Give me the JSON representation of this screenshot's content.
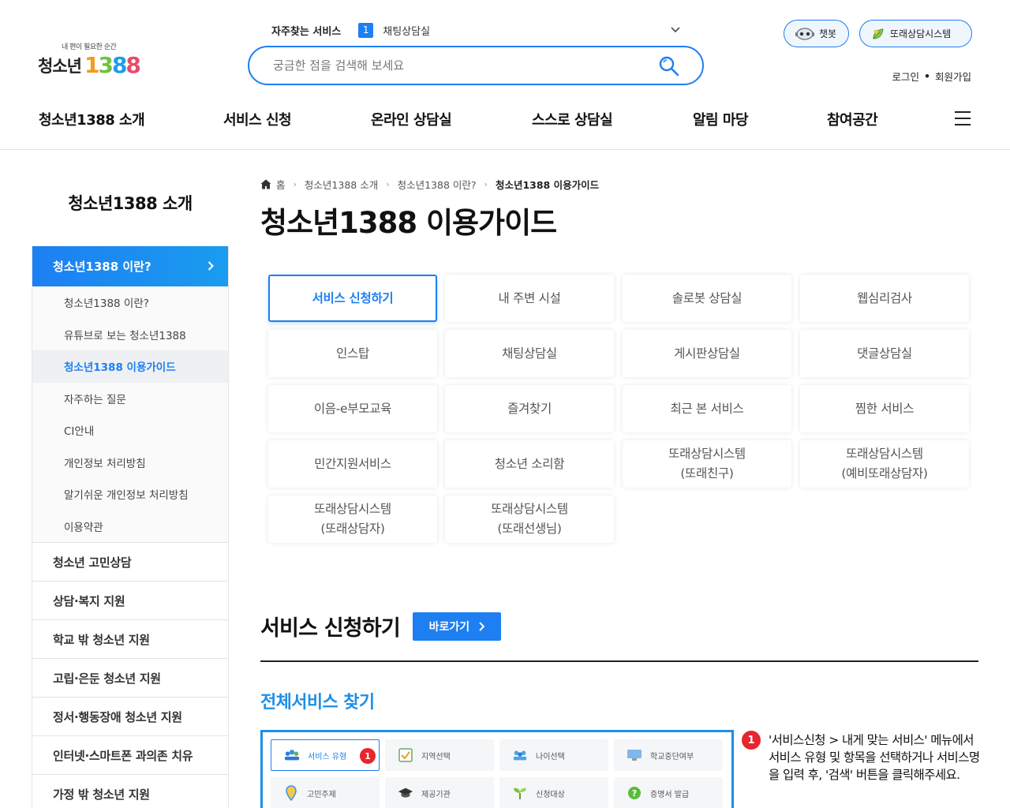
{
  "header": {
    "logo_tagline": "내 편이 필요한 순간",
    "logo_text": "청소년",
    "logo_digits": [
      "1",
      "3",
      "8",
      "8"
    ],
    "faq_label": "자주찾는 서비스",
    "faq_rank": "1",
    "faq_item": "채팅상담실",
    "search_placeholder": "궁금한 점을 검색해 보세요",
    "chatbot_label": "챗봇",
    "ttorae_label": "또래상담시스템",
    "login_label": "로그인",
    "signup_label": "회원가입",
    "separator": "•"
  },
  "gnb": [
    "청소년1388 소개",
    "서비스 신청",
    "온라인 상담실",
    "스스로 상담실",
    "알림 마당",
    "참여공간"
  ],
  "sidebar": {
    "title": "청소년1388 소개",
    "active": "청소년1388 이란?",
    "sub_items": [
      "청소년1388 이란?",
      "유튜브로 보는 청소년1388",
      "청소년1388 이용가이드",
      "자주하는 질문",
      "CI안내",
      "개인정보 처리방침",
      "알기쉬운 개인정보 처리방침",
      "이용약관"
    ],
    "items": [
      "청소년 고민상담",
      "상담·복지 지원",
      "학교 밖 청소년 지원",
      "고립·은둔 청소년 지원",
      "정서·행동장애 청소년 지원",
      "인터넷·스마트폰 과의존 치유",
      "가정 밖 청소년 지원"
    ]
  },
  "breadcrumb": {
    "home": "홈",
    "items": [
      "청소년1388 소개",
      "청소년1388 이란?"
    ],
    "current": "청소년1388 이용가이드"
  },
  "page_title": "청소년1388 이용가이드",
  "tabs": [
    "서비스 신청하기",
    "내 주변 시설",
    "솔로봇 상담실",
    "웹심리검사",
    "인스탑",
    "채팅상담실",
    "게시판상담실",
    "댓글상담실",
    "이음-e부모교육",
    "즐겨찾기",
    "최근 본 서비스",
    "찜한 서비스",
    "민간지원서비스",
    "청소년 소리함",
    "또래상담시스템\n(또래친구)",
    "또래상담시스템\n(예비또래상담자)",
    "또래상담시스템\n(또래상담자)",
    "또래상담시스템\n(또래선생님)"
  ],
  "section": {
    "title": "서비스 신청하기",
    "go_label": "바로가기",
    "sub_title": "전체서비스 찾기"
  },
  "mini_screenshot": {
    "items": [
      {
        "label": "서비스 유형",
        "icon": "people-icon"
      },
      {
        "label": "지역선택",
        "icon": "check-icon"
      },
      {
        "label": "나이선택",
        "icon": "group-icon"
      },
      {
        "label": "학교중단여부",
        "icon": "monitor-icon"
      },
      {
        "label": "고민주제",
        "icon": "pin-icon"
      },
      {
        "label": "제공기관",
        "icon": "graduation-icon"
      },
      {
        "label": "신청대상",
        "icon": "sprout-icon"
      },
      {
        "label": "증명서 발급",
        "icon": "question-icon"
      }
    ],
    "badge": "1"
  },
  "note": {
    "num": "1",
    "text": "'서비스신청 > 내게 맞는 서비스' 메뉴에서 서비스 유형 및 항목을 선택하거나 서비스명을 입력 후, '검색' 버튼을 클릭해주세요."
  },
  "colors": {
    "primary": "#1d7ff2",
    "accent_text": "#1d8fe8",
    "badge_red": "#e8262d"
  }
}
